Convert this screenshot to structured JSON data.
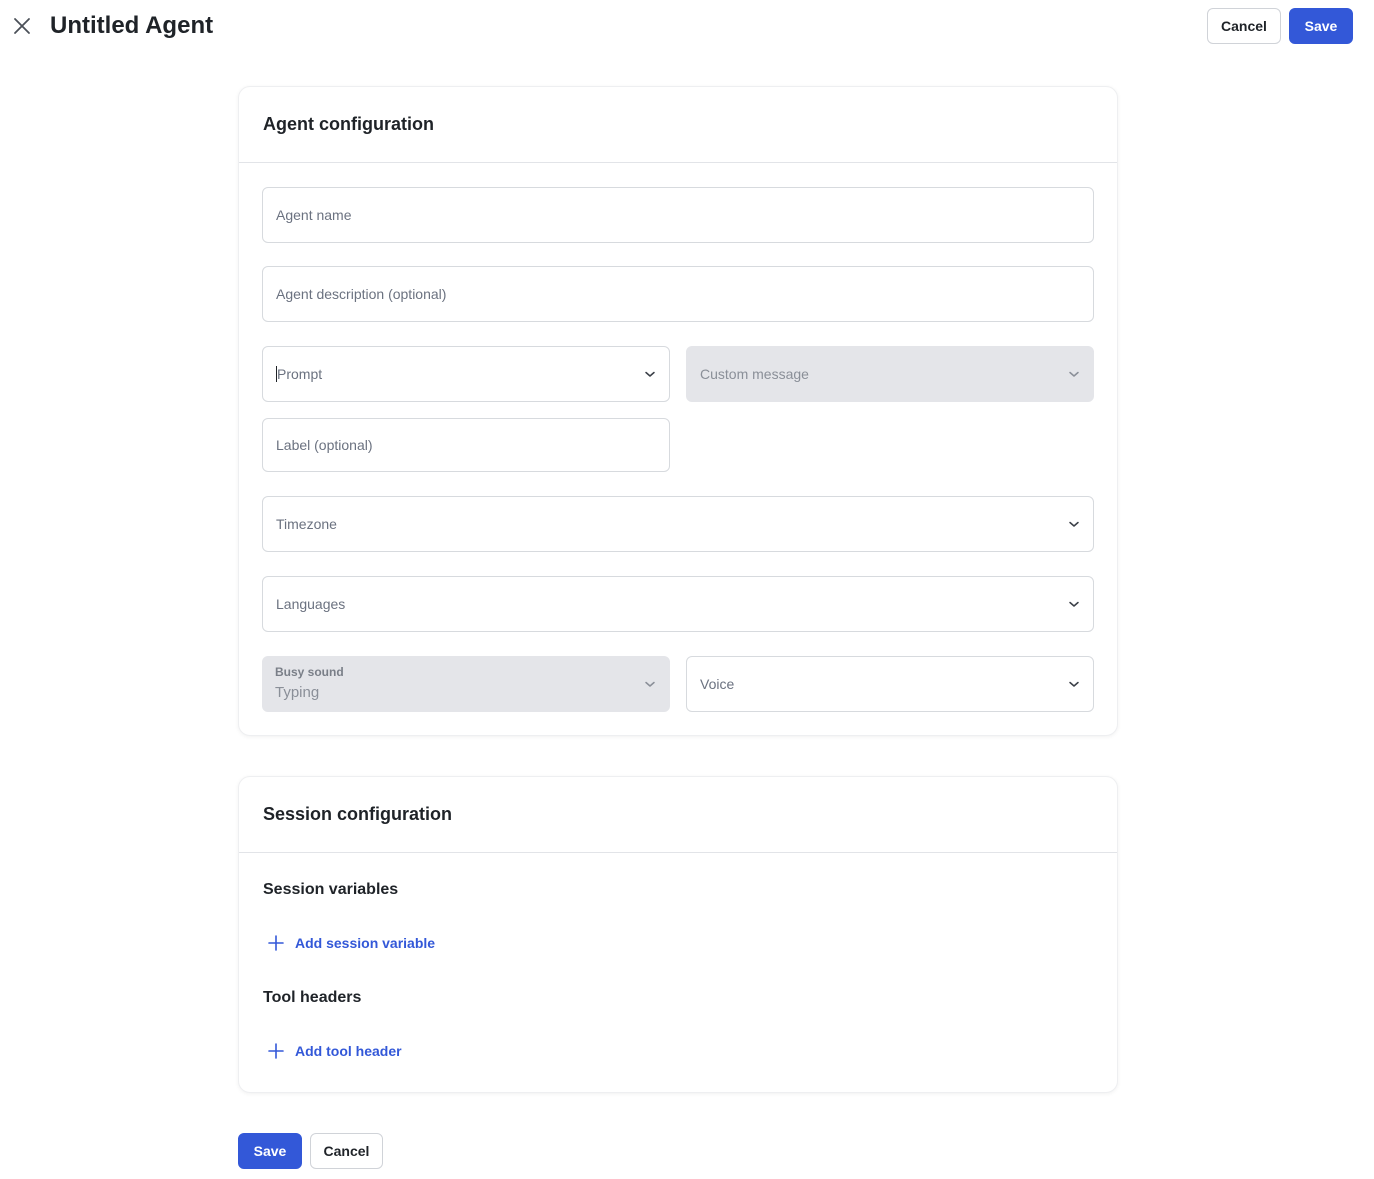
{
  "header": {
    "title": "Untitled Agent",
    "cancel_label": "Cancel",
    "save_label": "Save"
  },
  "agent_config": {
    "title": "Agent configuration",
    "agent_name_placeholder": "Agent name",
    "agent_description_placeholder": "Agent description (optional)",
    "prompt_placeholder": "Prompt",
    "custom_message_placeholder": "Custom message",
    "label_placeholder": "Label (optional)",
    "timezone_placeholder": "Timezone",
    "languages_placeholder": "Languages",
    "busy_sound_label": "Busy sound",
    "busy_sound_value": "Typing",
    "voice_placeholder": "Voice"
  },
  "session_config": {
    "title": "Session configuration",
    "session_variables_heading": "Session variables",
    "add_session_variable_label": "Add session variable",
    "tool_headers_heading": "Tool headers",
    "add_tool_header_label": "Add tool header"
  },
  "footer": {
    "save_label": "Save",
    "cancel_label": "Cancel"
  },
  "colors": {
    "primary": "#3358d8",
    "disabled_field": "#e4e5e9",
    "border": "#d7dade"
  },
  "icons": {
    "close": "close-icon",
    "chevron": "chevron-down-icon",
    "plus": "plus-icon"
  }
}
